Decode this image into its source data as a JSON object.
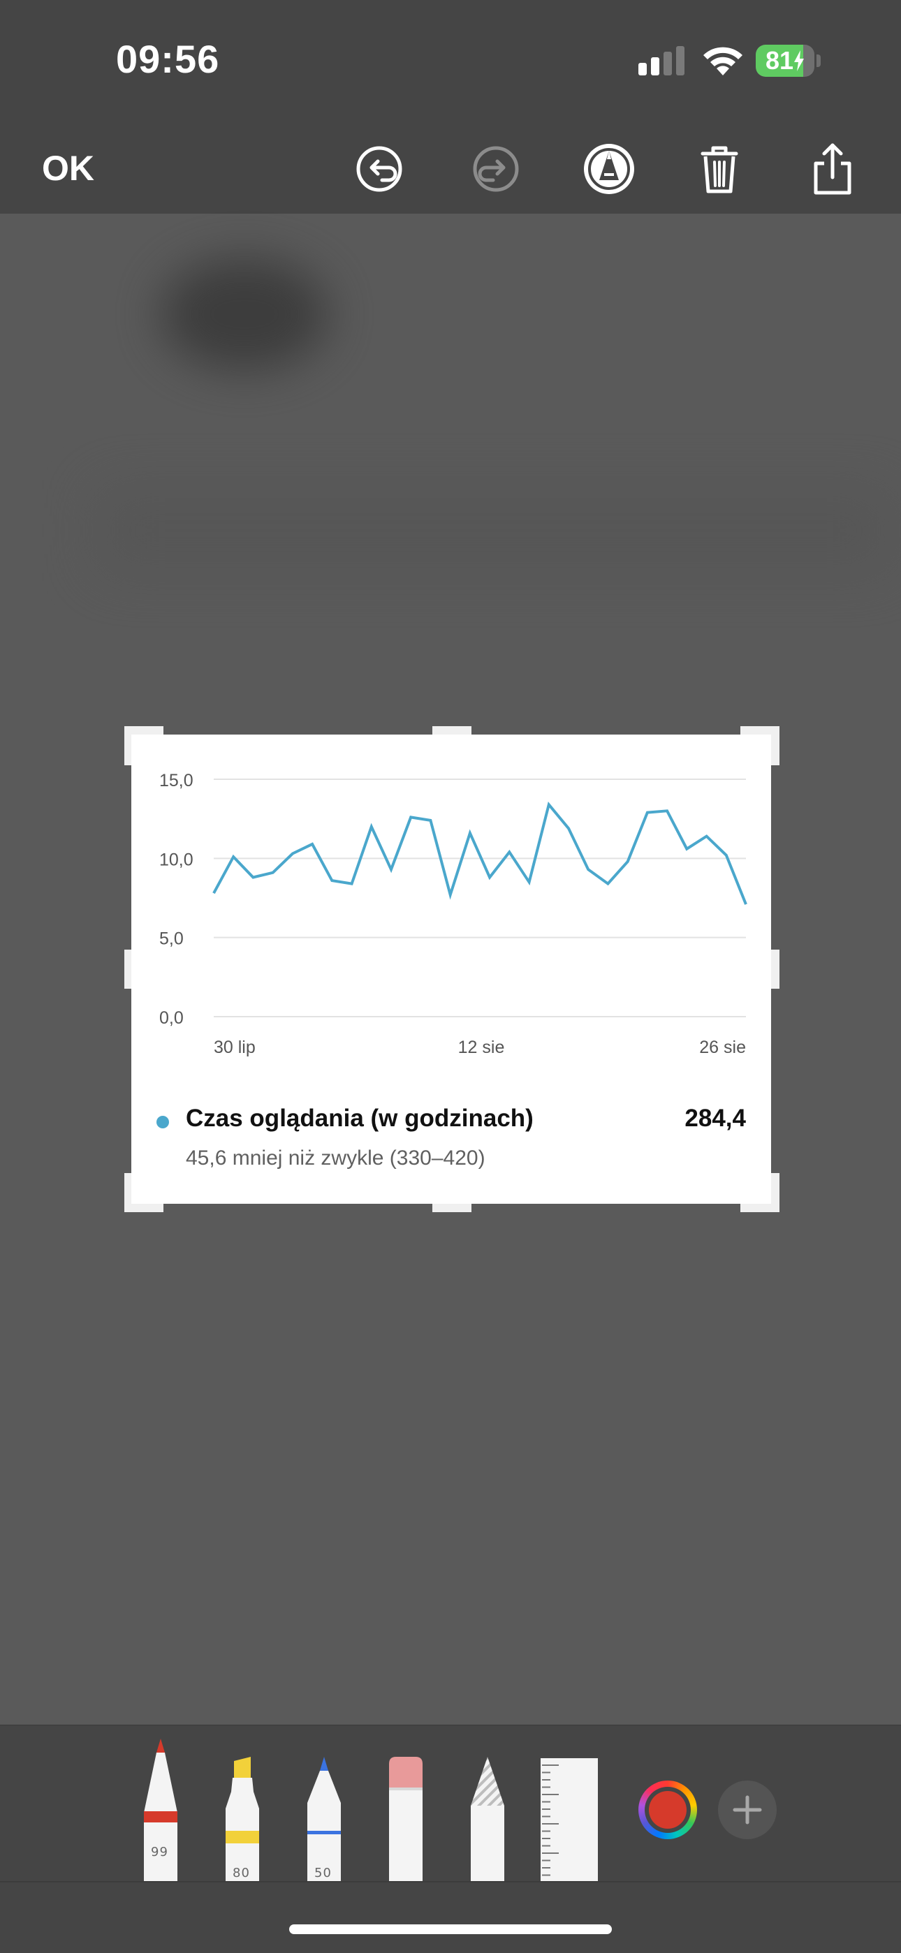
{
  "status_bar": {
    "time": "09:56",
    "battery": {
      "percent_label": "81",
      "level": 0.81,
      "charging": true
    }
  },
  "toolbar": {
    "ok_label": "OK",
    "icons": [
      "undo-icon",
      "redo-icon",
      "markup-pen-icon",
      "trash-icon",
      "share-icon"
    ]
  },
  "card": {
    "legend_title": "Czas oglądania (w godzinach)",
    "legend_value": "284,4",
    "legend_sub": "45,6 mniej niż zwykle (330–420)"
  },
  "chart_data": {
    "type": "line",
    "y_ticks": [
      "15,0",
      "10,0",
      "5,0",
      "0,0"
    ],
    "x_tick_labels": [
      "30 lip",
      "12 sie",
      "26 sie"
    ],
    "ylim": [
      0,
      15
    ],
    "grid": true,
    "series": [
      {
        "color": "#4aa7cc",
        "values": [
          7.8,
          10.1,
          8.8,
          9.1,
          10.3,
          10.9,
          8.6,
          8.4,
          12.0,
          9.3,
          12.6,
          12.4,
          7.7,
          11.6,
          8.8,
          10.4,
          8.5,
          13.4,
          11.9,
          9.3,
          8.4,
          9.8,
          12.9,
          13.0,
          10.6,
          11.4,
          10.2,
          7.1
        ]
      }
    ]
  },
  "palette": {
    "tools": [
      {
        "name": "pen",
        "number": "99",
        "tip_color": "#d63a2b"
      },
      {
        "name": "marker",
        "number": "80",
        "tip_color": "#f2d13a"
      },
      {
        "name": "pencil",
        "number": "50",
        "tip_color": "#3b73e0"
      },
      {
        "name": "eraser"
      },
      {
        "name": "lasso"
      },
      {
        "name": "ruler"
      }
    ],
    "selected_color": "#d63a2b"
  }
}
